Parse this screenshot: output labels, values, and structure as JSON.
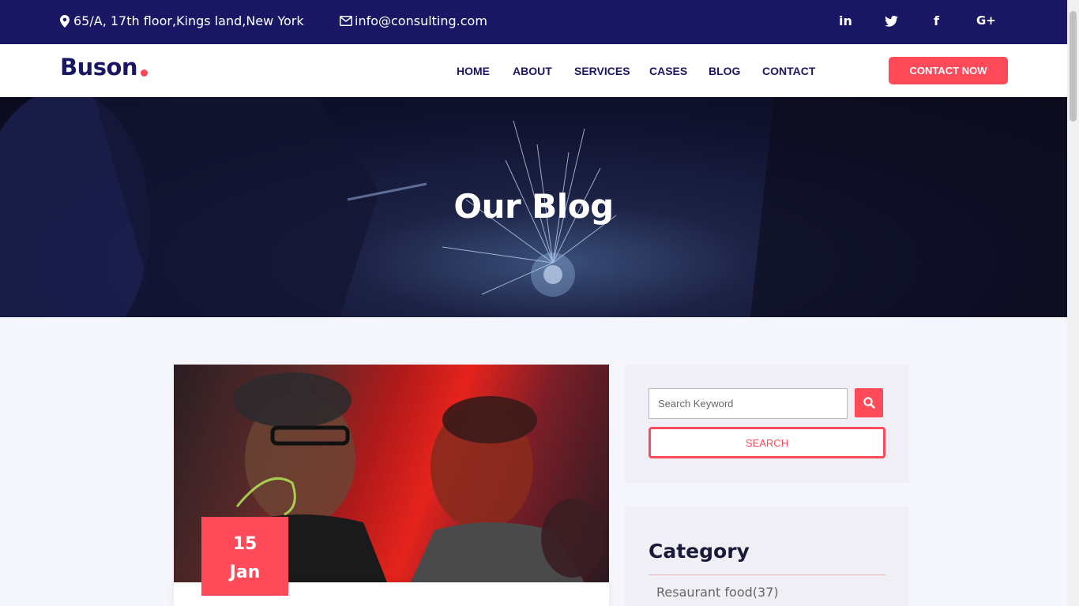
{
  "topbar": {
    "address": "65/A, 17th floor,Kings land,New York",
    "email": "info@consulting.com",
    "social": {
      "linkedin": "in",
      "twitter_icon": "twitter-icon",
      "facebook": "f",
      "googleplus": "G+"
    }
  },
  "header": {
    "logo": "Buson",
    "nav": [
      "HOME",
      "ABOUT",
      "SERVICES",
      "CASES",
      "BLOG",
      "CONTACT"
    ],
    "cta": "CONTACT NOW"
  },
  "hero": {
    "title": "Our Blog"
  },
  "post": {
    "day": "15",
    "month": "Jan"
  },
  "sidebar": {
    "search_placeholder": "Search Keyword",
    "search_button": "SEARCH",
    "category_title": "Category",
    "categories": [
      "Resaurant food(37)"
    ]
  },
  "colors": {
    "navy": "#1a1764",
    "accent": "#ff4a5a"
  }
}
